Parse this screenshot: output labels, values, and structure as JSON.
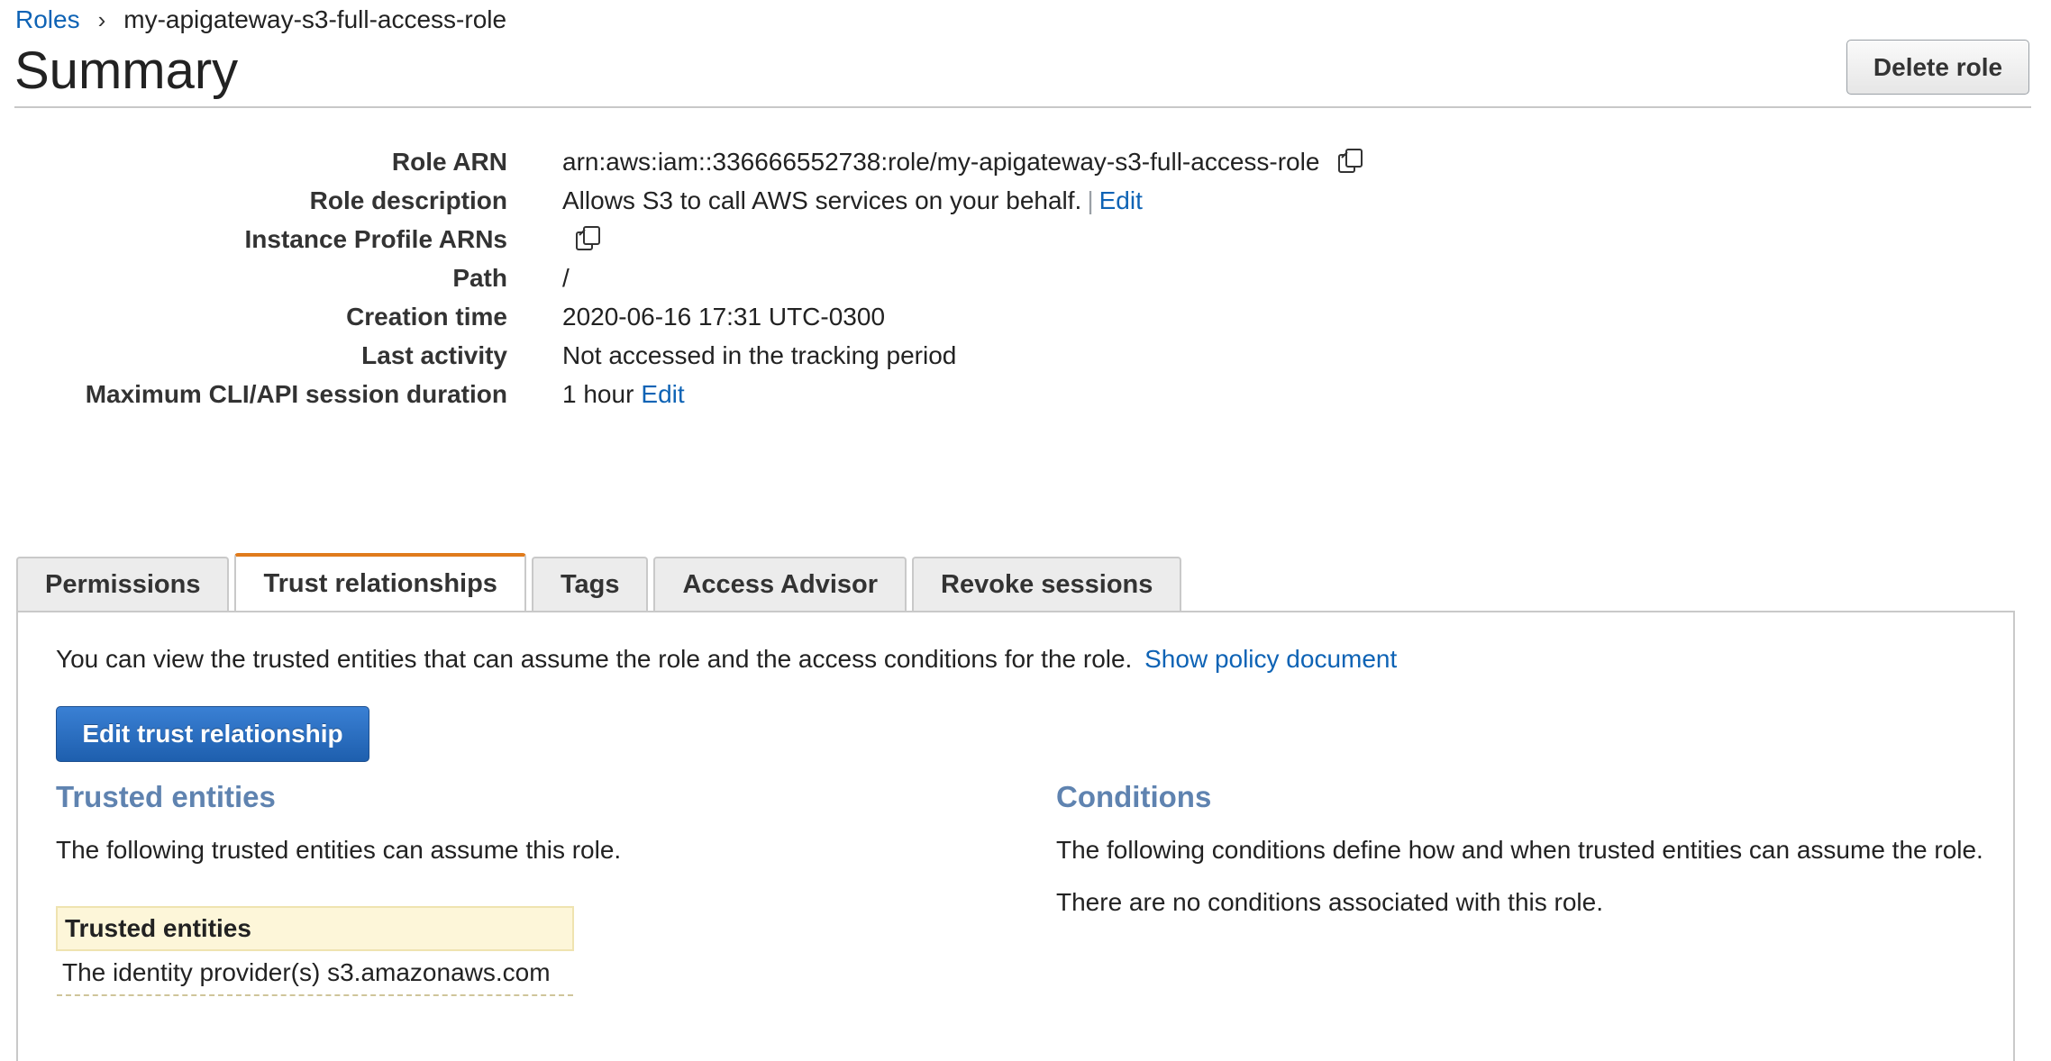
{
  "breadcrumb": {
    "root": "Roles",
    "current": "my-apigateway-s3-full-access-role"
  },
  "header": {
    "title": "Summary",
    "delete_label": "Delete role"
  },
  "summary": {
    "role_arn": {
      "label": "Role ARN",
      "value": "arn:aws:iam::336666552738:role/my-apigateway-s3-full-access-role"
    },
    "role_description": {
      "label": "Role description",
      "value": "Allows S3 to call AWS services on your behalf.",
      "separator": "|",
      "edit": "Edit"
    },
    "instance_profile": {
      "label": "Instance Profile ARNs"
    },
    "path": {
      "label": "Path",
      "value": "/"
    },
    "creation_time": {
      "label": "Creation time",
      "value": "2020-06-16 17:31 UTC-0300"
    },
    "last_activity": {
      "label": "Last activity",
      "value": "Not accessed in the tracking period"
    },
    "max_session": {
      "label": "Maximum CLI/API session duration",
      "value": "1 hour",
      "edit": "Edit"
    }
  },
  "tabs": [
    {
      "label": "Permissions",
      "active": false
    },
    {
      "label": "Trust relationships",
      "active": true
    },
    {
      "label": "Tags",
      "active": false
    },
    {
      "label": "Access Advisor",
      "active": false
    },
    {
      "label": "Revoke sessions",
      "active": false
    }
  ],
  "trust": {
    "intro": "You can view the trusted entities that can assume the role and the access conditions for the role.",
    "show_policy": "Show policy document",
    "edit_button": "Edit trust relationship",
    "entities_heading": "Trusted entities",
    "entities_desc": "The following trusted entities can assume this role.",
    "table_header": "Trusted entities",
    "table_rows": [
      "The identity provider(s) s3.amazonaws.com"
    ],
    "conditions_heading": "Conditions",
    "conditions_desc": "The following conditions define how and when trusted entities can assume the role.",
    "conditions_none": "There are no conditions associated with this role."
  },
  "colors": {
    "link": "#0e63b5",
    "active_tab_accent": "#e07b1c",
    "section_heading": "#5f83b0",
    "primary_button": "#1e5fae"
  },
  "icons": {
    "copy": "copy-icon",
    "breadcrumb_separator": "chevron-right-icon"
  }
}
